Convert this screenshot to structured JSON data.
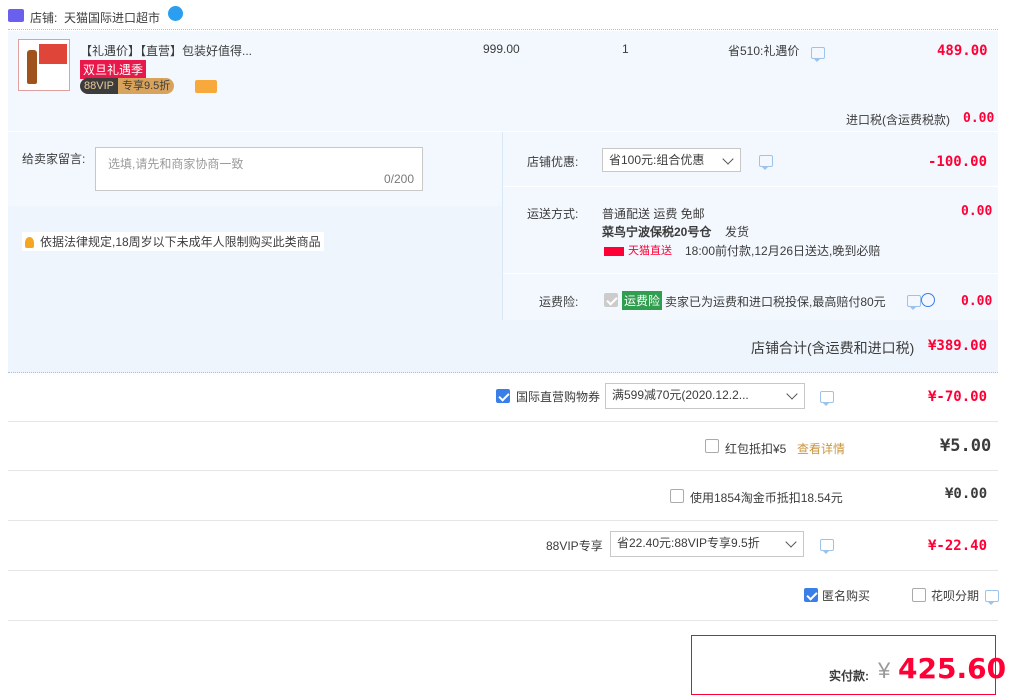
{
  "store": {
    "label": "店铺:",
    "name": "天猫国际进口超市"
  },
  "product": {
    "title": "【礼遇价】【直营】包装好值得...",
    "badge_promo": "双旦礼遇季",
    "vip_badge": "88VIP",
    "vip_discount": "专享9.5折",
    "unit_price": "999.00",
    "quantity": "1",
    "saving": "省510:礼遇价",
    "subtotal": "489.00"
  },
  "import_tax": {
    "label": "进口税(含运费税款)",
    "value": "0.00"
  },
  "message": {
    "label": "给卖家留言:",
    "placeholder": "选填,请先和商家协商一致",
    "counter": "0/200"
  },
  "legal_notice": "依据法律规定,18周岁以下未成年人限制购买此类商品",
  "store_discount": {
    "label": "店铺优惠:",
    "selected": "省100元:组合优惠",
    "value": "-100.00"
  },
  "shipping": {
    "label": "运送方式:",
    "method": "普通配送 运费 免邮",
    "warehouse": "菜鸟宁波保税20号仓",
    "dispatch": "发货",
    "direct_badge": "天猫直送",
    "eta": "18:00前付款,12月26日送达,晚到必赔",
    "value": "0.00"
  },
  "insurance": {
    "label": "运费险:",
    "tag": "运费险",
    "text": "卖家已为运费和进口税投保,最高赔付80元",
    "value": "0.00"
  },
  "store_total": {
    "label": "店铺合计(含运费和进口税)",
    "value": "¥389.00"
  },
  "coupon": {
    "label": "国际直营购物券",
    "selected": "满599减70元(2020.12.2...",
    "value": "¥-70.00",
    "checked": true
  },
  "red_packet": {
    "label": "红包抵扣¥5",
    "link": "查看详情",
    "value": "¥5.00",
    "checked": false
  },
  "taojinbi": {
    "label": "使用1854淘金币抵扣18.54元",
    "value": "¥0.00",
    "checked": false
  },
  "vip88": {
    "label": "88VIP专享",
    "selected": "省22.40元:88VIP专享9.5折",
    "value": "¥-22.40"
  },
  "anonymous": {
    "label": "匿名购买",
    "checked": true
  },
  "huabei": {
    "label": "花呗分期",
    "checked": false
  },
  "payment": {
    "label": "实付款:",
    "currency": "¥",
    "amount": "425.60"
  },
  "colors": {
    "accent": "#ff0036",
    "blue_bg": "#eef5fc",
    "border_blue": "#b4d0ee"
  }
}
